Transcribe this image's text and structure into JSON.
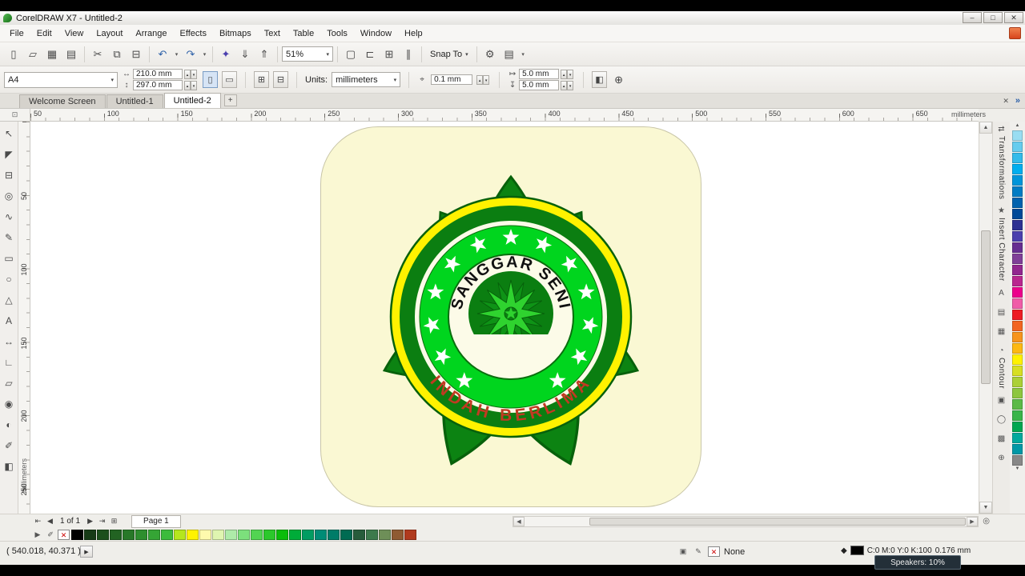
{
  "window": {
    "title": "CorelDRAW X7 - Untitled-2"
  },
  "menubar": {
    "items": [
      "File",
      "Edit",
      "View",
      "Layout",
      "Arrange",
      "Effects",
      "Bitmaps",
      "Text",
      "Table",
      "Tools",
      "Window",
      "Help"
    ]
  },
  "icons": {
    "minimize": "–",
    "maximize": "□",
    "close": "✕",
    "dropdown": "▾",
    "spin_up": "▴",
    "spin_down": "▾",
    "plus": "+",
    "expand": "»",
    "corner": "⊡",
    "portrait": "▯",
    "landscape": "▭",
    "all_pages": "⊞",
    "current_page": "⊟",
    "nudge": "⌖",
    "width_icon": "↔",
    "height_icon": "↕",
    "dup_x": "↦",
    "dup_y": "↧",
    "treat_filled": "◧",
    "whats_new": "⊕",
    "scroll_up": "▲",
    "scroll_down": "▼",
    "scroll_left": "◀",
    "scroll_right": "▶",
    "page_first": "⇤",
    "page_prev": "◀",
    "page_next": "▶",
    "page_last": "⇥",
    "add_page": "⊞",
    "magnifier": "◎",
    "play": "▶",
    "eyedropper": "✐",
    "none": "✕",
    "pen": "◆",
    "status_icon1": "▣",
    "status_icon2": "✎"
  },
  "std_toolbar": {
    "zoom_value": "51%",
    "snap_to_label": "Snap To",
    "group1": [
      {
        "name": "new-document-icon",
        "glyph": "▯"
      },
      {
        "name": "open-icon",
        "glyph": "▱"
      },
      {
        "name": "save-icon",
        "glyph": "▦"
      },
      {
        "name": "print-icon",
        "glyph": "▤"
      }
    ],
    "group2": [
      {
        "name": "cut-icon",
        "glyph": "✂"
      },
      {
        "name": "copy-icon",
        "glyph": "⧉"
      },
      {
        "name": "paste-icon",
        "glyph": "⊟"
      }
    ],
    "group3": [
      {
        "name": "undo-icon",
        "glyph": "↶",
        "color": "#2F62A8",
        "dropdown": true
      },
      {
        "name": "redo-icon",
        "glyph": "↷",
        "color": "#2F62A8",
        "dropdown": true
      }
    ],
    "group4": [
      {
        "name": "corel-connect-icon",
        "glyph": "✦",
        "color": "#4B3FAE"
      },
      {
        "name": "import-icon",
        "glyph": "⇓"
      },
      {
        "name": "export-icon",
        "glyph": "⇑"
      }
    ],
    "group5": [
      {
        "name": "fullscreen-preview-icon",
        "glyph": "▢"
      },
      {
        "name": "show-rulers-icon",
        "glyph": "⊏"
      },
      {
        "name": "show-grid-icon",
        "glyph": "⊞"
      },
      {
        "name": "show-guidelines-icon",
        "glyph": "∥"
      }
    ],
    "group6": [
      {
        "name": "options-icon",
        "glyph": "⚙"
      },
      {
        "name": "application-launcher-icon",
        "glyph": "▤",
        "dropdown": true
      }
    ]
  },
  "property_bar": {
    "page_size": "A4",
    "width_value": "210.0 mm",
    "height_value": "297.0 mm",
    "units_label": "Units:",
    "units_value": "millimeters",
    "nudge_value": "0.1 mm",
    "dup_x": "5.0 mm",
    "dup_y": "5.0 mm"
  },
  "tabs": {
    "items": [
      "Welcome Screen",
      "Untitled-1",
      "Untitled-2"
    ],
    "active_index": 2
  },
  "rulers": {
    "h_labels": [
      "50",
      "100",
      "150",
      "200",
      "250",
      "300",
      "350",
      "400",
      "450",
      "500",
      "550",
      "600",
      "650"
    ],
    "v_labels": [
      "50",
      "100",
      "150",
      "200",
      "250"
    ],
    "units_label": "millimeters"
  },
  "toolbox": {
    "tools": [
      {
        "name": "pick-tool",
        "glyph": "↖"
      },
      {
        "name": "shape-tool",
        "glyph": "◤"
      },
      {
        "name": "crop-tool",
        "glyph": "⊟"
      },
      {
        "name": "zoom-tool",
        "glyph": "◎"
      },
      {
        "name": "freehand-tool",
        "glyph": "∿"
      },
      {
        "name": "artistic-media-tool",
        "glyph": "✎"
      },
      {
        "name": "rectangle-tool",
        "glyph": "▭"
      },
      {
        "name": "ellipse-tool",
        "glyph": "○"
      },
      {
        "name": "polygon-tool",
        "glyph": "△"
      },
      {
        "name": "text-tool",
        "glyph": "A"
      },
      {
        "name": "parallel-dimension-tool",
        "glyph": "↔"
      },
      {
        "name": "connector-tool",
        "glyph": "∟"
      },
      {
        "name": "drop-shadow-tool",
        "glyph": "▱"
      },
      {
        "name": "contour-tool",
        "glyph": "◉"
      },
      {
        "name": "blend-tool",
        "glyph": "◐"
      },
      {
        "name": "color-eyedropper-tool",
        "glyph": "✐"
      },
      {
        "name": "interactive-fill-tool",
        "glyph": "◧"
      }
    ]
  },
  "canvas": {
    "logo": {
      "top_text": "SANGGAR SENI",
      "bottom_text": "INDAH BERLIMA"
    },
    "colors": {
      "background": "#FAF8D3",
      "petal_green": "#0C8312",
      "ring_yellow": "#FFF200",
      "ring_dark_green": "#0B7E11",
      "ring_bright_green": "#00D51E",
      "ring_ivory": "#FCFBE8",
      "center_green": "#0B7E11",
      "pinwheel_lime": "#2FD32F",
      "pinwheel_dark": "#0E9316",
      "text_black": "#111111",
      "text_red": "#C13A22"
    }
  },
  "dockers": {
    "tabs": [
      {
        "name": "docker-tab-transformations",
        "icon": "⇄",
        "label": "Transformations"
      },
      {
        "name": "docker-tab-insert-character",
        "icon": "★",
        "label": "Insert Character"
      },
      {
        "name": "docker-tab-contour",
        "icon": "◔",
        "label": "Contour"
      }
    ],
    "extra_icons": [
      {
        "name": "docker-icon-text",
        "glyph": "A"
      },
      {
        "name": "docker-icon-pages",
        "glyph": "▤"
      },
      {
        "name": "docker-icon-grid",
        "glyph": "▦"
      }
    ],
    "bottom_icons": [
      {
        "name": "docker-icon-object",
        "glyph": "▣"
      },
      {
        "name": "docker-icon-lens",
        "glyph": "◯"
      },
      {
        "name": "docker-icon-pattern",
        "glyph": "▩"
      },
      {
        "name": "docker-icon-add",
        "glyph": "⊕"
      }
    ]
  },
  "palette_right": {
    "colors": [
      "#99DDF2",
      "#66CCEE",
      "#33BBEA",
      "#00AEEF",
      "#0095DA",
      "#007CC4",
      "#0062AE",
      "#004A98",
      "#2E3192",
      "#4B3FAE",
      "#662D91",
      "#7F3F98",
      "#92278F",
      "#B9278F",
      "#EC008C",
      "#F05DA8",
      "#ED1C24",
      "#F26522",
      "#F7941D",
      "#FDB913",
      "#FFF200",
      "#D7DF23",
      "#ABD037",
      "#8DC63F",
      "#5BBA47",
      "#39B54A",
      "#00A651",
      "#00A99D",
      "#0098A6",
      "#888888"
    ]
  },
  "palette_bottom": {
    "colors": [
      "#000000",
      "#173B17",
      "#1C4F1C",
      "#226322",
      "#287828",
      "#2E8E2E",
      "#35A535",
      "#3CBB3C",
      "#B5E61D",
      "#FFF200",
      "#FFFAAD",
      "#DFF5B0",
      "#AEEBA9",
      "#7CE07C",
      "#52D452",
      "#2BC82B",
      "#0ABD0A",
      "#00AC39",
      "#009C62",
      "#008C76",
      "#007C68",
      "#006B52",
      "#275C3B",
      "#3D7A4C",
      "#6E8F58",
      "#8F5B33",
      "#B03A1E"
    ]
  },
  "page_nav": {
    "count_label": "1 of 1",
    "page_tab": "Page 1"
  },
  "status_bar": {
    "coords": "( 540.018, 40.371 )",
    "fill_none_label": "None",
    "color_info": "C:0 M:0 Y:0 K:100",
    "outline_width": "0.176 mm",
    "tooltip": "Speakers: 10%"
  }
}
